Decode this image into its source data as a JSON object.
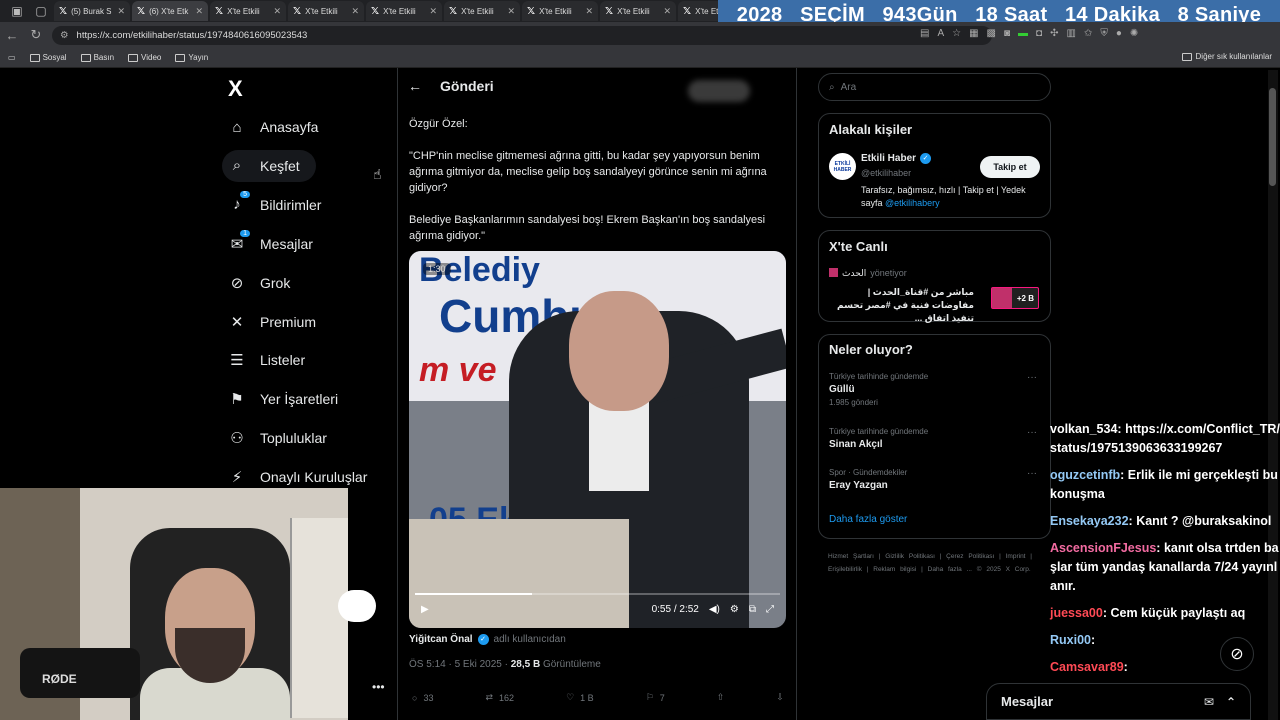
{
  "browser": {
    "tabs": [
      {
        "title": "(5) Burak S",
        "active": false
      },
      {
        "title": "(6) X'te Etk",
        "active": true
      },
      {
        "title": "X'te Etkili",
        "active": false
      },
      {
        "title": "X'te Etkili",
        "active": false
      },
      {
        "title": "X'te Etkili",
        "active": false
      },
      {
        "title": "X'te Etkili",
        "active": false
      },
      {
        "title": "X'te Etkili",
        "active": false
      },
      {
        "title": "X'te Etkili",
        "active": false
      },
      {
        "title": "X'te Et",
        "active": false
      }
    ],
    "url": "https://x.com/etkilihaber/status/1974840616095023543",
    "bookmarks": [
      "Sosyal",
      "Basın",
      "Video",
      "Yayın"
    ],
    "other_bookmarks": "Diğer sık kullanılanlar"
  },
  "countdown": {
    "year": "2028",
    "label": "SEÇİM",
    "days": "943",
    "days_unit": "Gün",
    "hours": "18",
    "hours_unit": "Saat",
    "minutes": "14",
    "minutes_unit": "Dakika",
    "seconds": "8",
    "seconds_unit": "Saniye"
  },
  "sidebar": {
    "logo": "X",
    "items": [
      {
        "label": "Anasayfa",
        "icon": "home-icon",
        "glyph": "⌂"
      },
      {
        "label": "Keşfet",
        "icon": "search-icon",
        "glyph": "⌕"
      },
      {
        "label": "Bildirimler",
        "icon": "bell-icon",
        "glyph": "♪",
        "badge": "5"
      },
      {
        "label": "Mesajlar",
        "icon": "mail-icon",
        "glyph": "✉",
        "badge": "1"
      },
      {
        "label": "Grok",
        "icon": "grok-icon",
        "glyph": "⊘"
      },
      {
        "label": "Premium",
        "icon": "x-icon",
        "glyph": "✕"
      },
      {
        "label": "Listeler",
        "icon": "list-icon",
        "glyph": "☰"
      },
      {
        "label": "Yer İşaretleri",
        "icon": "bookmark-icon",
        "glyph": "⚑"
      },
      {
        "label": "Topluluklar",
        "icon": "people-icon",
        "glyph": "⚇"
      },
      {
        "label": "Onaylı Kuruluşlar",
        "icon": "lightning-icon",
        "glyph": "⚡"
      }
    ]
  },
  "webcam": {
    "mic_brand": "RØDE"
  },
  "post": {
    "header": "Gönderi",
    "speaker": "Özgür Özel:",
    "quote1": "\"CHP'nin meclise gitmemesi ağrına gitti, bu kadar şey yapıyorsun benim ağrıma gitmiyor da, meclise gelip boş sandalyeyi görünce senin mi ağrına gidiyor?",
    "quote2": "Belediye Başkanlarımın sandalyesi boş! Ekrem Başkan'ın boş sandalyesi ağrıma gidiyor.\"",
    "video": {
      "badge": "1:30",
      "time": "0:55 / 2:52",
      "progress": 0.32,
      "banner_top": "Belediy",
      "banner_mid": "Cumhuriy",
      "banner_red": "m ve",
      "banner_low": "05 Ek      5 Paz"
    },
    "author": "Yiğitcan Önal",
    "author_note": "adlı kullanıcıdan",
    "time": "ÖS 5:14 · 5 Eki 2025 · ",
    "views": "28,5 B",
    "views_label": " Görüntüleme",
    "replies": "33",
    "reposts": "162",
    "likes": "1 B",
    "bookmarks": "7"
  },
  "right": {
    "search_placeholder": "Ara",
    "related": {
      "title": "Alakalı kişiler",
      "name": "Etkili Haber",
      "handle": "@etkilihaber",
      "follow": "Takip et",
      "bio": "Tarafsız, bağımsız, hızlı | Takip et | Yedek sayfa ",
      "bio_link": "@etkilihabery",
      "avatar_text": "ETKİLİ HABER"
    },
    "live": {
      "title": "X'te Canlı",
      "host": "الحدث",
      "host_note": "yönetiyor",
      "text": "مباشر من #قناة_الحدث | مفاوضات فنية في #مصر تحسم تنفيذ اتفاق ...",
      "count": "+2 B"
    },
    "trends": {
      "title": "Neler oluyor?",
      "items": [
        {
          "context": "Türkiye tarihinde gündemde",
          "name": "Güllü",
          "count": "1.985 gönderi"
        },
        {
          "context": "Türkiye tarihinde gündemde",
          "name": "Sinan Akçıl",
          "count": ""
        },
        {
          "context": "Spor · Gündemdekiler",
          "name": "Eray Yazgan",
          "count": ""
        }
      ],
      "more": "Daha fazla göster"
    },
    "footer": "Hizmet Şartları | Gizlilik Politikası | Çerez Politikası | Imprint | Erişilebilirlik | Reklam bilgisi | Daha fazla ... © 2025 X Corp."
  },
  "chat": [
    {
      "user": "volkan_534",
      "msg": "https://x.com/Conflict_TR/status/1975139063633199267",
      "color": "white"
    },
    {
      "user": "oguzcetinfb",
      "msg": "Erlik ile mi gerçekleşti bu konuşma",
      "color": "blue"
    },
    {
      "user": "Ensekaya232",
      "msg": "Kanıt ? @buraksakinol",
      "color": "blue"
    },
    {
      "user": "AscensionFJesus",
      "msg": "kanıt olsa trtden başlar tüm yandaş kanallarda 7/24 yayınlanır.",
      "color": "pink"
    },
    {
      "user": "juessa00",
      "msg": "Cem küçük paylaştı aq",
      "color": "red"
    },
    {
      "user": "Ruxi00",
      "msg": "",
      "color": "blue"
    },
    {
      "user": "Camsavar89",
      "msg": "",
      "color": "red"
    }
  ],
  "dm": {
    "label": "Mesajlar"
  }
}
